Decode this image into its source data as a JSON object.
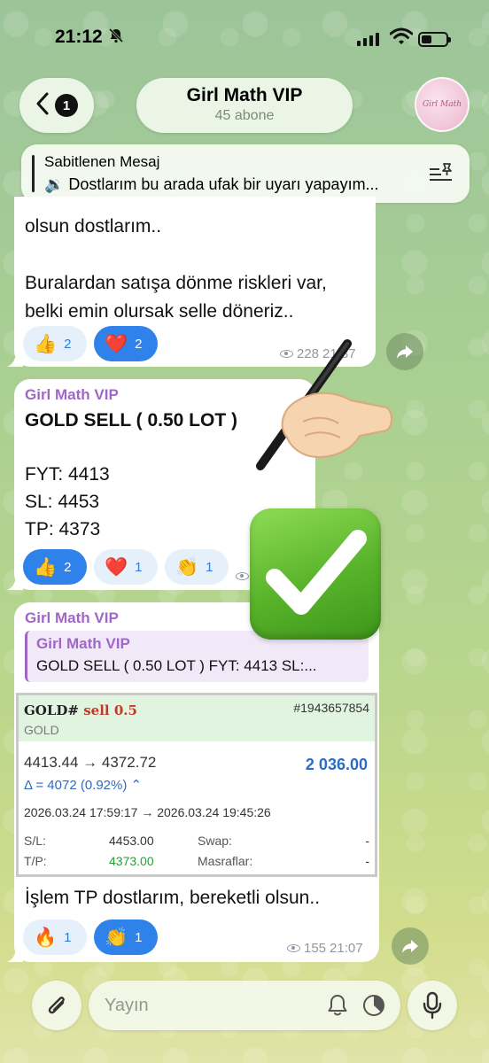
{
  "status": {
    "time": "21:12"
  },
  "header": {
    "back_badge": "1",
    "title": "Girl Math VIP",
    "subtitle": "45 abone",
    "avatar_text": "Girl Math"
  },
  "pinned": {
    "label": "Sabitlenen Mesaj",
    "text": "🔉 Dostlarım bu arada ufak bir uyarı yapayım..."
  },
  "messages": [
    {
      "text_line1": "olsun dostlarım..",
      "text_line2": "Buralardan satışa dönme riskleri var,",
      "text_line3": "belki emin olursak selle döneriz..",
      "reactions": [
        {
          "emoji": "👍",
          "count": "2"
        },
        {
          "emoji": "❤️",
          "count": "2"
        }
      ],
      "views": "228",
      "time": "21:37"
    },
    {
      "sender": "Girl Math VIP",
      "title": "GOLD SELL ( 0.50 LOT )",
      "fyt": "FYT: 4413",
      "sl": "SL: 4453",
      "tp": "TP: 4373",
      "reactions": [
        {
          "emoji": "👍",
          "count": "2"
        },
        {
          "emoji": "❤️",
          "count": "1"
        },
        {
          "emoji": "👏",
          "count": "1"
        }
      ]
    },
    {
      "sender": "Girl Math VIP",
      "reply_name": "Girl Math VIP",
      "reply_preview": "GOLD SELL ( 0.50 LOT ) FYT: 4413 SL:...",
      "trade": {
        "symbol": "GOLD#",
        "side": "sell 0.5",
        "symbol_sub": "GOLD",
        "ticket": "#1943657854",
        "prices": "4413.44 → 4372.72",
        "profit": "2 036.00",
        "delta": "Δ = 4072 (0.92%) ⌃",
        "times": "2026.03.24 17:59:17 → 2026.03.24 19:45:26",
        "sl_label": "S/L:",
        "sl_value": "4453.00",
        "tp_label": "T/P:",
        "tp_value": "4373.00",
        "swap_label": "Swap:",
        "swap_value": "-",
        "fees_label": "Masraflar:",
        "fees_value": "-"
      },
      "text": "İşlem TP dostlarım, bereketli olsun..",
      "reactions": [
        {
          "emoji": "🔥",
          "count": "1"
        },
        {
          "emoji": "👏",
          "count": "1"
        }
      ],
      "views": "155",
      "time": "21:07"
    }
  ],
  "composer": {
    "placeholder": "Yayın"
  },
  "colors": {
    "accent": "#2f82ea",
    "sender": "#a067c8",
    "profit": "#2b6cc4",
    "tp_green": "#2d9b3a",
    "sell_red": "#c0392b"
  },
  "icons": [
    "bell-slash-icon",
    "signal-icon",
    "wifi-icon",
    "battery-icon",
    "chevron-left-icon",
    "pin-list-icon",
    "eye-icon",
    "share-icon",
    "paperclip-icon",
    "bell-icon",
    "timer-icon",
    "microphone-icon"
  ]
}
